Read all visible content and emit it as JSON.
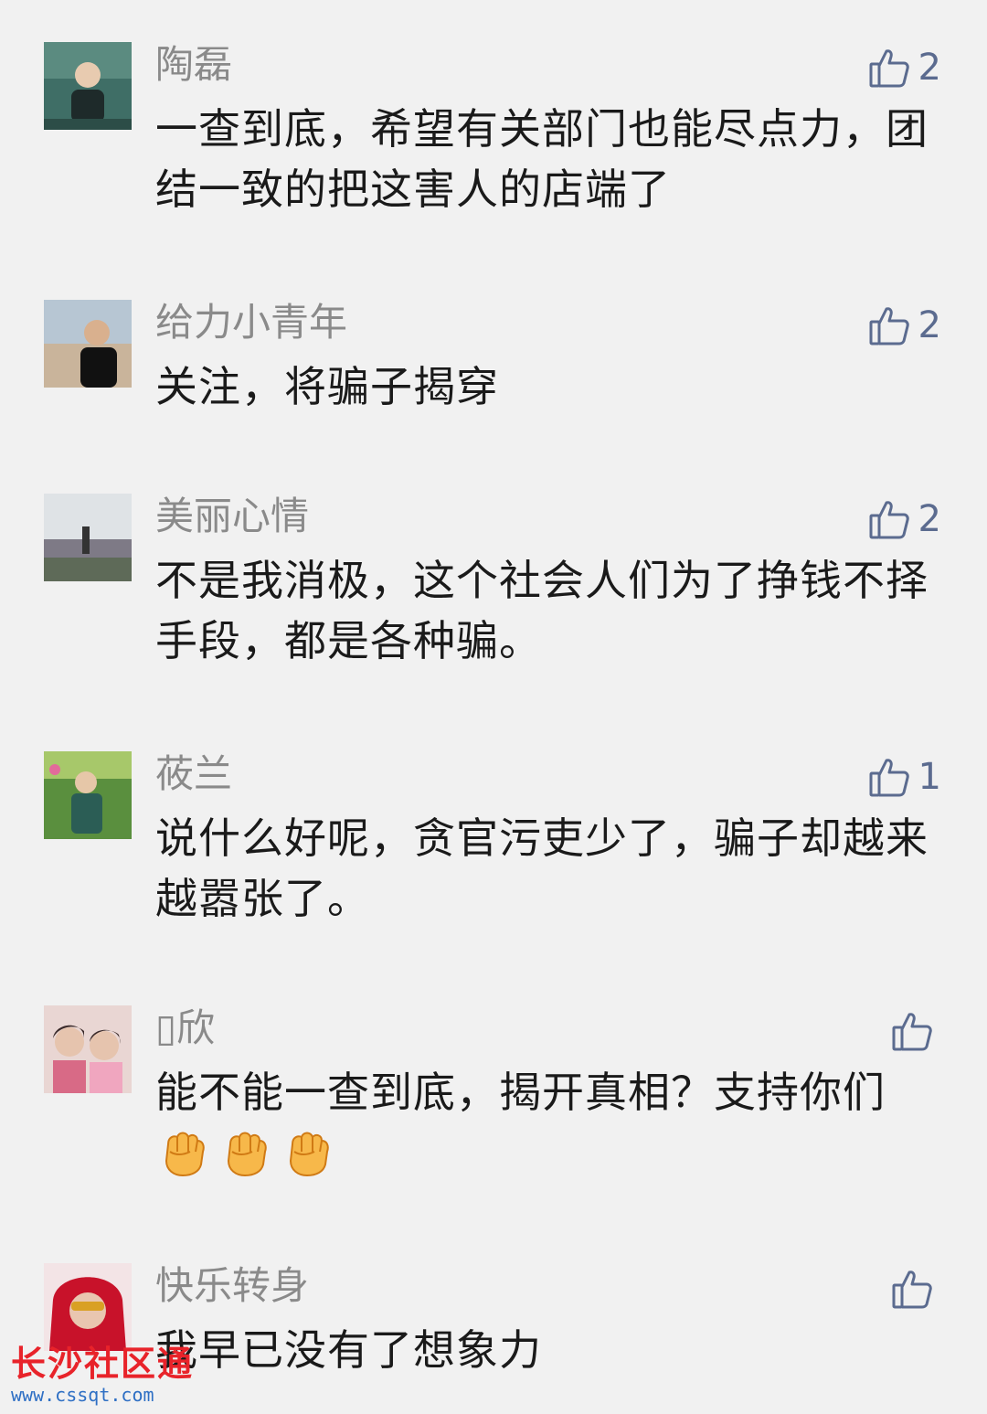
{
  "comments": [
    {
      "name": "陶磊",
      "likes": "2",
      "text": "一查到底，希望有关部门也能尽点力，团结一致的把这害人的店端了"
    },
    {
      "name": "给力小青年",
      "likes": "2",
      "text": "关注，将骗子揭穿"
    },
    {
      "name": "美丽心情",
      "likes": "2",
      "text": "不是我消极，这个社会人们为了挣钱不择手段，都是各种骗。"
    },
    {
      "name": "莜兰",
      "likes": "1",
      "text": "说什么好呢，贪官污吏少了，骗子却越来越嚣张了。"
    },
    {
      "name": "▯欣",
      "likes": "",
      "text": "能不能一查到底，揭开真相？支持你们"
    },
    {
      "name": "快乐转身",
      "likes": "",
      "text": "我早已没有了想象力"
    }
  ],
  "icons": {
    "like": "thumbs-up-outline-icon",
    "fist": "raised-fist-emoji-icon"
  },
  "colors": {
    "background": "#f1f1f1",
    "name": "#8a8a8a",
    "text": "#1a1a1a",
    "like": "#5b6b8f",
    "watermark_title": "#e8232a",
    "watermark_url": "#2e6fc4"
  },
  "watermark": {
    "title": "长沙社区通",
    "url": "www.cssqt.com"
  }
}
